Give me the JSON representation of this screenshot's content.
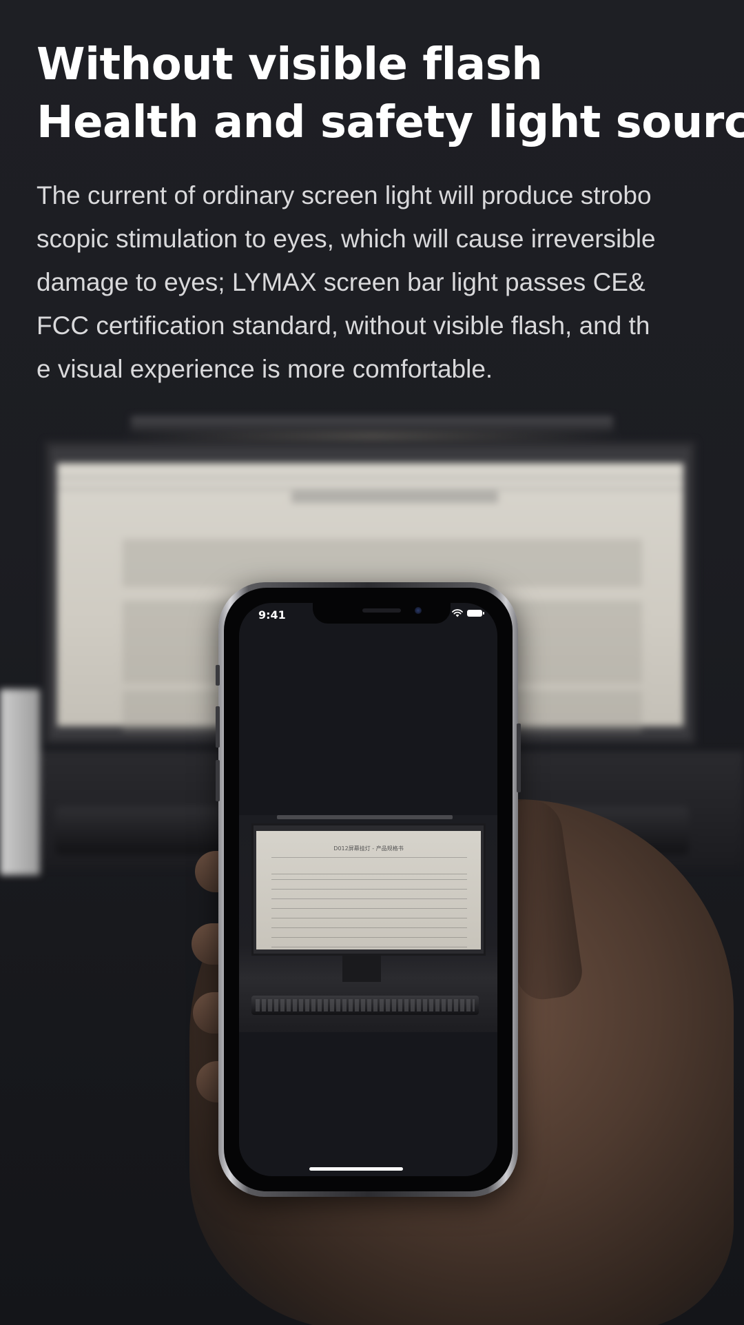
{
  "headline": {
    "line1": "Without visible flash",
    "line2": "Health and safety light source"
  },
  "body": {
    "lines": [
      "The current of ordinary screen light will produce strobo",
      "scopic stimulation to eyes, which will cause irreversible",
      "damage to eyes; LYMAX screen bar light passes CE&",
      "FCC certification standard, without visible flash, and th",
      "e visual experience is more comfortable."
    ]
  },
  "phone": {
    "status_time": "9:41",
    "status_icons": [
      "signal-icon",
      "wifi-icon",
      "battery-icon"
    ],
    "photo_document_title": "D012屏幕挂灯 - 产品规格书"
  },
  "colors": {
    "background": "#1b1c20",
    "headline": "#ffffff",
    "body_text": "#d9d9db"
  }
}
